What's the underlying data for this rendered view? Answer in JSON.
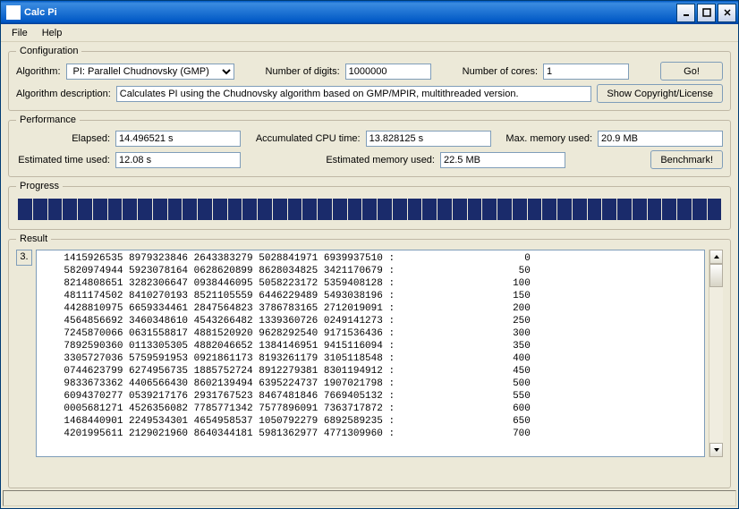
{
  "title": "Calc Pi",
  "menu": {
    "file": "File",
    "help": "Help"
  },
  "config": {
    "legend": "Configuration",
    "algorithm_label": "Algorithm:",
    "algorithm_value": "PI: Parallel Chudnovsky (GMP)",
    "digits_label": "Number of digits:",
    "digits_value": "1000000",
    "cores_label": "Number of cores:",
    "cores_value": "1",
    "go_label": "Go!",
    "desc_label": "Algorithm description:",
    "desc_value": "Calculates PI using the Chudnovsky algorithm based on GMP/MPIR, multithreaded version.",
    "license_label": "Show Copyright/License"
  },
  "perf": {
    "legend": "Performance",
    "elapsed_label": "Elapsed:",
    "elapsed_value": "14.496521 s",
    "cpu_label": "Accumulated CPU time:",
    "cpu_value": "13.828125 s",
    "mem_label": "Max. memory used:",
    "mem_value": "20.9 MB",
    "est_time_label": "Estimated time used:",
    "est_time_value": "12.08 s",
    "est_mem_label": "Estimated memory used:",
    "est_mem_value": "22.5 MB",
    "benchmark_label": "Benchmark!"
  },
  "progress": {
    "legend": "Progress"
  },
  "result": {
    "legend": "Result",
    "prefix": "3.",
    "lines": [
      {
        "digits": "1415926535 8979323846 2643383279 5028841971 6939937510",
        "offset": "0"
      },
      {
        "digits": "5820974944 5923078164 0628620899 8628034825 3421170679",
        "offset": "50"
      },
      {
        "digits": "8214808651 3282306647 0938446095 5058223172 5359408128",
        "offset": "100"
      },
      {
        "digits": "4811174502 8410270193 8521105559 6446229489 5493038196",
        "offset": "150"
      },
      {
        "digits": "4428810975 6659334461 2847564823 3786783165 2712019091",
        "offset": "200"
      },
      {
        "digits": "4564856692 3460348610 4543266482 1339360726 0249141273",
        "offset": "250"
      },
      {
        "digits": "7245870066 0631558817 4881520920 9628292540 9171536436",
        "offset": "300"
      },
      {
        "digits": "7892590360 0113305305 4882046652 1384146951 9415116094",
        "offset": "350"
      },
      {
        "digits": "3305727036 5759591953 0921861173 8193261179 3105118548",
        "offset": "400"
      },
      {
        "digits": "0744623799 6274956735 1885752724 8912279381 8301194912",
        "offset": "450"
      },
      {
        "digits": "9833673362 4406566430 8602139494 6395224737 1907021798",
        "offset": "500"
      },
      {
        "digits": "6094370277 0539217176 2931767523 8467481846 7669405132",
        "offset": "550"
      },
      {
        "digits": "0005681271 4526356082 7785771342 7577896091 7363717872",
        "offset": "600"
      },
      {
        "digits": "1468440901 2249534301 4654958537 1050792279 6892589235",
        "offset": "650"
      },
      {
        "digits": "4201995611 2129021960 8640344181 5981362977 4771309960",
        "offset": "700"
      }
    ]
  }
}
